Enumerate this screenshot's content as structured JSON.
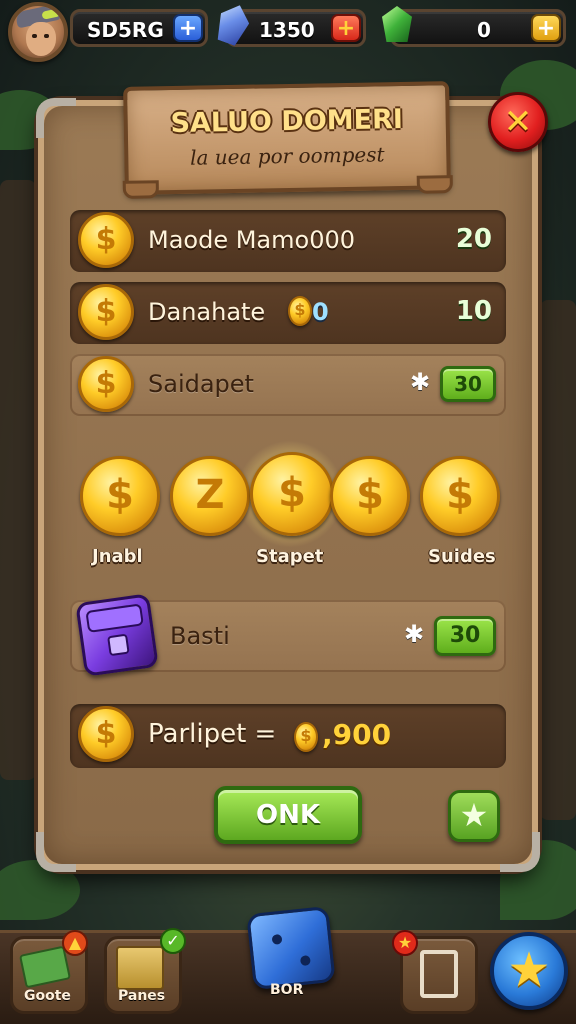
{
  "currencies": {
    "player_code": "SD5RG",
    "blue_gems": "1350",
    "green_gems": "0"
  },
  "panel": {
    "title": "SALUO DOMERI",
    "subtitle": "la uea por oompest",
    "close": "✕"
  },
  "rows": [
    {
      "label": "Maode Mamo000",
      "amount": "20"
    },
    {
      "label": "Danahate",
      "inline_value": "0",
      "amount": "10"
    },
    {
      "label": "Saidapet",
      "button": "30"
    }
  ],
  "coin_picker": {
    "coins": [
      "$",
      "Z",
      "$",
      "$",
      "$"
    ],
    "labels": [
      "Jnabl",
      "Stapet",
      "Suides"
    ]
  },
  "chest_row": {
    "label": "Basti",
    "button": "30"
  },
  "total_row": {
    "label": "Parlipet =",
    "value": ",900"
  },
  "ok_button": "ONK",
  "bottom_nav": {
    "items": [
      {
        "label": "Goote"
      },
      {
        "label": "Panes"
      },
      {
        "label": "BOR"
      },
      {
        "label": ""
      },
      {
        "label": ""
      }
    ],
    "badge_check": "✓"
  }
}
